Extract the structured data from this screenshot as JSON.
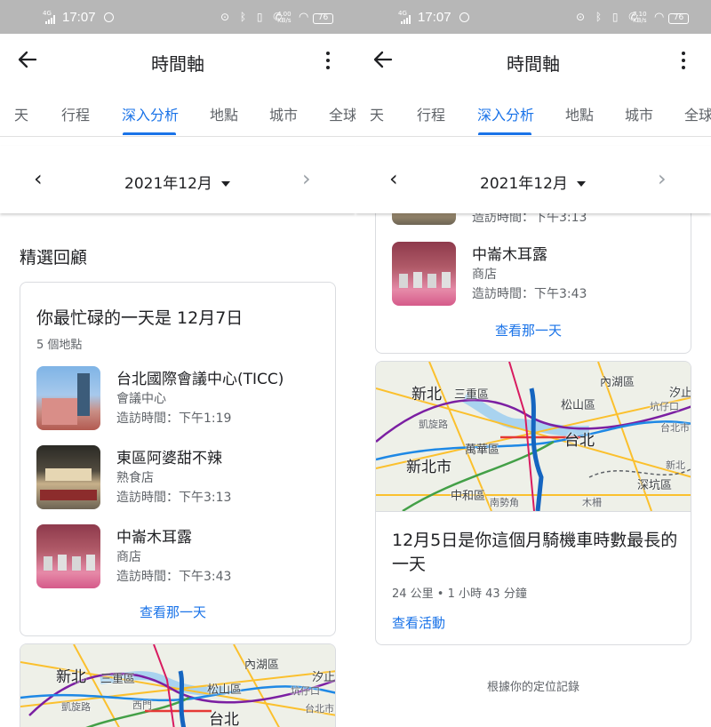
{
  "status_bar": {
    "time": "17:07",
    "network": "4G",
    "battery": "76",
    "speed_left": [
      "4.00",
      "KB/s"
    ],
    "speed_right": [
      "7.10",
      "KB/s"
    ]
  },
  "app_bar": {
    "title": "時間軸"
  },
  "tabs_left": [
    "天",
    "行程",
    "深入分析",
    "地點",
    "城市",
    "全球"
  ],
  "tabs_right": [
    "天",
    "行程",
    "深入分析",
    "地點",
    "城市",
    "全球"
  ],
  "active_tab": "深入分析",
  "month_selector": {
    "label": "2021年12月"
  },
  "highlights": {
    "section_title": "精選回顧",
    "busiest_day": {
      "title": "你最忙碌的一天是 12月7日",
      "count": "5 個地點",
      "places": [
        {
          "name": "台北國際會議中心(TICC)",
          "type": "會議中心",
          "visit_time": "造訪時間：下午1:19",
          "thumb_colors": [
            "#7fb4e6",
            "#c98f86"
          ]
        },
        {
          "name": "東區阿婆甜不辣",
          "type": "熟食店",
          "visit_time": "造訪時間：下午3:13",
          "thumb_colors": [
            "#3b3a33",
            "#c7b08a"
          ]
        },
        {
          "name": "中崙木耳露",
          "type": "商店",
          "visit_time": "造訪時間：下午3:43",
          "thumb_colors": [
            "#8e3a4c",
            "#e68aa8"
          ]
        }
      ],
      "link": "查看那一天"
    }
  },
  "right": {
    "partial_place_time": "造訪時間：下午3:13",
    "partial_place": {
      "name": "中崙木耳露",
      "type": "商店",
      "visit_time": "造訪時間：下午3:43"
    },
    "partial_link": "查看那一天",
    "motorcycle_card": {
      "title": "12月5日是你這個月騎機車時數最長的一天",
      "meta": "24 公里 • 1 小時 43 分鐘",
      "link": "查看活動"
    },
    "footer": "根據你的定位記錄"
  },
  "map_labels": {
    "xinbei": "新北",
    "sanchong": "三重區",
    "neihu": "內湖區",
    "xizhi": "汐止",
    "songshan": "松山區",
    "taipei": "台北",
    "fuxing": "坑仔口",
    "wanhua": "萬華區",
    "xinbeishi": "新北市",
    "zhonghe": "中和區",
    "nanshijiao": "南勢角",
    "shenkeng": "深坑區",
    "muzha": "木柵",
    "xinbei2": "新北",
    "taibei2": "台北市",
    "xiheng": "西門",
    "kaiyuan": "凱旋路"
  },
  "colors": {
    "accent": "#1a73e8",
    "title_text": "#202124",
    "secondary_text": "#5f6368",
    "divider": "#dadce0"
  }
}
